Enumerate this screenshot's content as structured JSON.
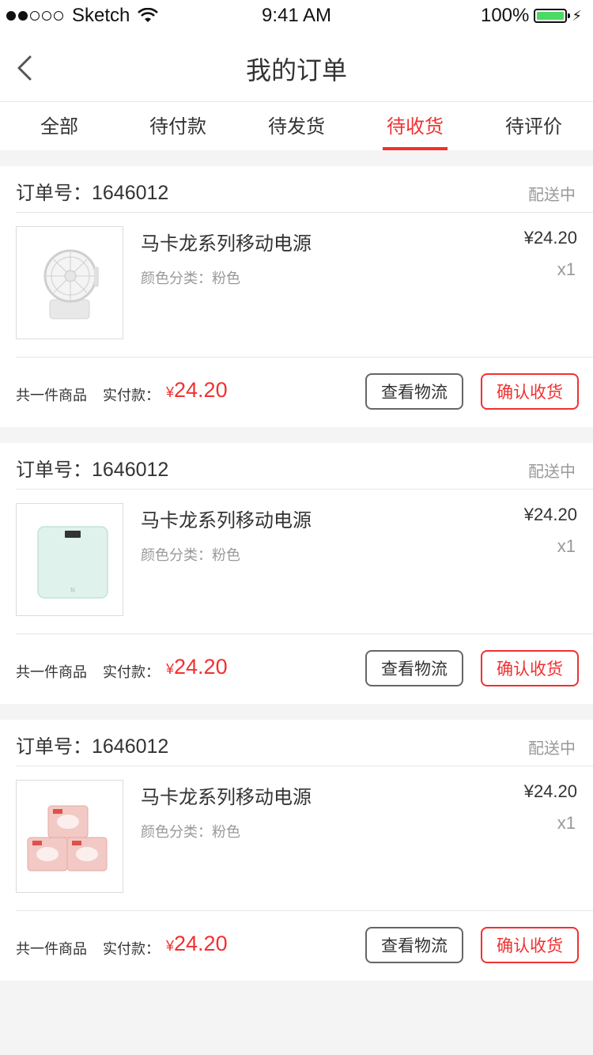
{
  "status_bar": {
    "carrier": "Sketch",
    "time": "9:41 AM",
    "battery": "100%",
    "battery_level": 1.0
  },
  "nav": {
    "title": "我的订单",
    "back_icon": "chevron-left-icon"
  },
  "tabs": [
    {
      "label": "全部",
      "active": false
    },
    {
      "label": "待付款",
      "active": false
    },
    {
      "label": "待发货",
      "active": false
    },
    {
      "label": "待收货",
      "active": true
    },
    {
      "label": "待评价",
      "active": false
    }
  ],
  "colors": {
    "accent": "#f23030",
    "background": "#f4f4f4"
  },
  "orders": [
    {
      "order_label": "订单号：",
      "order_no": "1646012",
      "status": "配送中",
      "product_name": "马卡龙系列移动电源",
      "spec": "颜色分类：粉色",
      "price": "¥24.20",
      "qty": "x1",
      "count_text": "共一件商品",
      "paid_label": "实付款：",
      "paid_currency": "¥",
      "paid_amount": "24.20",
      "logistics_btn": "查看物流",
      "confirm_btn": "确认收货",
      "image": "portable-fan"
    },
    {
      "order_label": "订单号：",
      "order_no": "1646012",
      "status": "配送中",
      "product_name": "马卡龙系列移动电源",
      "spec": "颜色分类：粉色",
      "price": "¥24.20",
      "qty": "x1",
      "count_text": "共一件商品",
      "paid_label": "实付款：",
      "paid_currency": "¥",
      "paid_amount": "24.20",
      "logistics_btn": "查看物流",
      "confirm_btn": "确认收货",
      "image": "bathroom-scale"
    },
    {
      "order_label": "订单号：",
      "order_no": "1646012",
      "status": "配送中",
      "product_name": "马卡龙系列移动电源",
      "spec": "颜色分类：粉色",
      "price": "¥24.20",
      "qty": "x1",
      "count_text": "共一件商品",
      "paid_label": "实付款：",
      "paid_currency": "¥",
      "paid_amount": "24.20",
      "logistics_btn": "查看物流",
      "confirm_btn": "确认收货",
      "image": "tissue-packs"
    }
  ]
}
